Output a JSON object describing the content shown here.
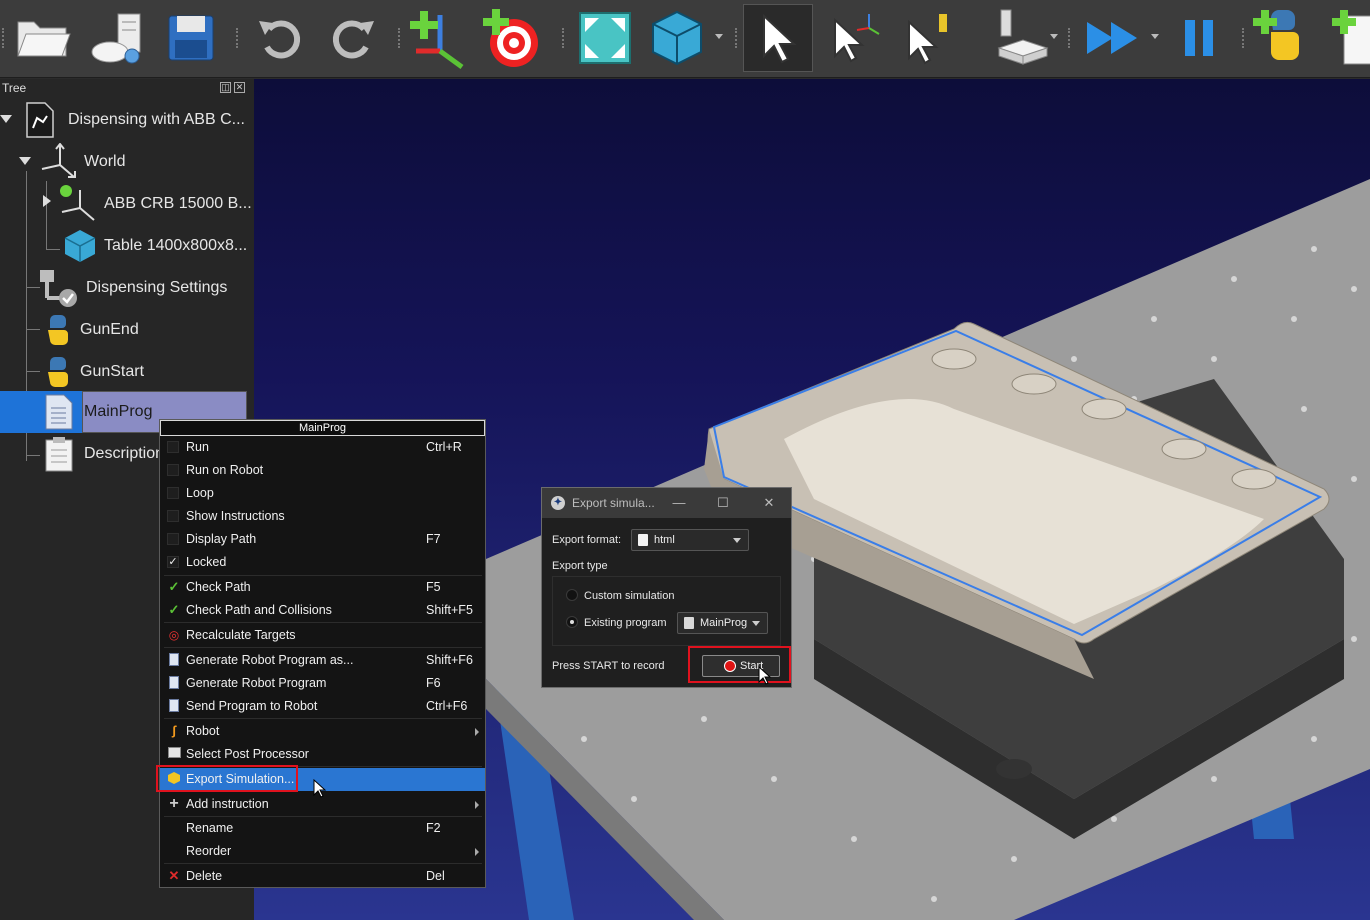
{
  "tree": {
    "header": "Tree",
    "items": [
      {
        "label": "Dispensing with ABB C...",
        "icon": "station-icon"
      },
      {
        "label": "World",
        "icon": "frame-icon"
      },
      {
        "label": "ABB CRB 15000 B...",
        "icon": "robot-frame-icon"
      },
      {
        "label": "Table 1400x800x8...",
        "icon": "cube-icon"
      },
      {
        "label": "Dispensing Settings",
        "icon": "dispensing-settings-icon"
      },
      {
        "label": "GunEnd",
        "icon": "python-icon"
      },
      {
        "label": "GunStart",
        "icon": "python-icon"
      },
      {
        "label": "MainProg",
        "icon": "program-icon"
      },
      {
        "label": "Description",
        "icon": "notes-icon"
      }
    ]
  },
  "context_menu": {
    "title": "MainProg",
    "items": [
      {
        "label": "Run",
        "shortcut": "Ctrl+R"
      },
      {
        "label": "Run on Robot",
        "shortcut": ""
      },
      {
        "label": "Loop",
        "shortcut": ""
      },
      {
        "label": "Show Instructions",
        "shortcut": ""
      },
      {
        "label": "Display Path",
        "shortcut": "F7"
      },
      {
        "label": "Locked",
        "shortcut": "",
        "checked": true
      },
      {
        "label": "Check Path",
        "shortcut": "F5"
      },
      {
        "label": "Check Path and Collisions",
        "shortcut": "Shift+F5"
      },
      {
        "label": "Recalculate Targets",
        "shortcut": ""
      },
      {
        "label": "Generate Robot Program as...",
        "shortcut": "Shift+F6"
      },
      {
        "label": "Generate Robot Program",
        "shortcut": "F6"
      },
      {
        "label": "Send Program to Robot",
        "shortcut": "Ctrl+F6"
      },
      {
        "label": "Robot",
        "shortcut": ""
      },
      {
        "label": "Select Post Processor",
        "shortcut": ""
      },
      {
        "label": "Export Simulation...",
        "shortcut": "",
        "highlighted": true
      },
      {
        "label": "Add instruction",
        "shortcut": ""
      },
      {
        "label": "Rename",
        "shortcut": "F2"
      },
      {
        "label": "Reorder",
        "shortcut": ""
      },
      {
        "label": "Delete",
        "shortcut": "Del"
      }
    ]
  },
  "export_dialog": {
    "title": "Export simula...",
    "format_label": "Export format:",
    "format_value": "html",
    "type_label": "Export type",
    "option_custom": "Custom simulation",
    "option_existing": "Existing program",
    "program_value": "MainProg",
    "record_hint": "Press START to record",
    "start_label": "Start"
  },
  "colors": {
    "selection": "#1e73d8",
    "menu_highlight": "#2a76d2",
    "callout": "#e0121e",
    "viewport_top": "#0d0d3a",
    "viewport_bottom": "#2a3590"
  }
}
